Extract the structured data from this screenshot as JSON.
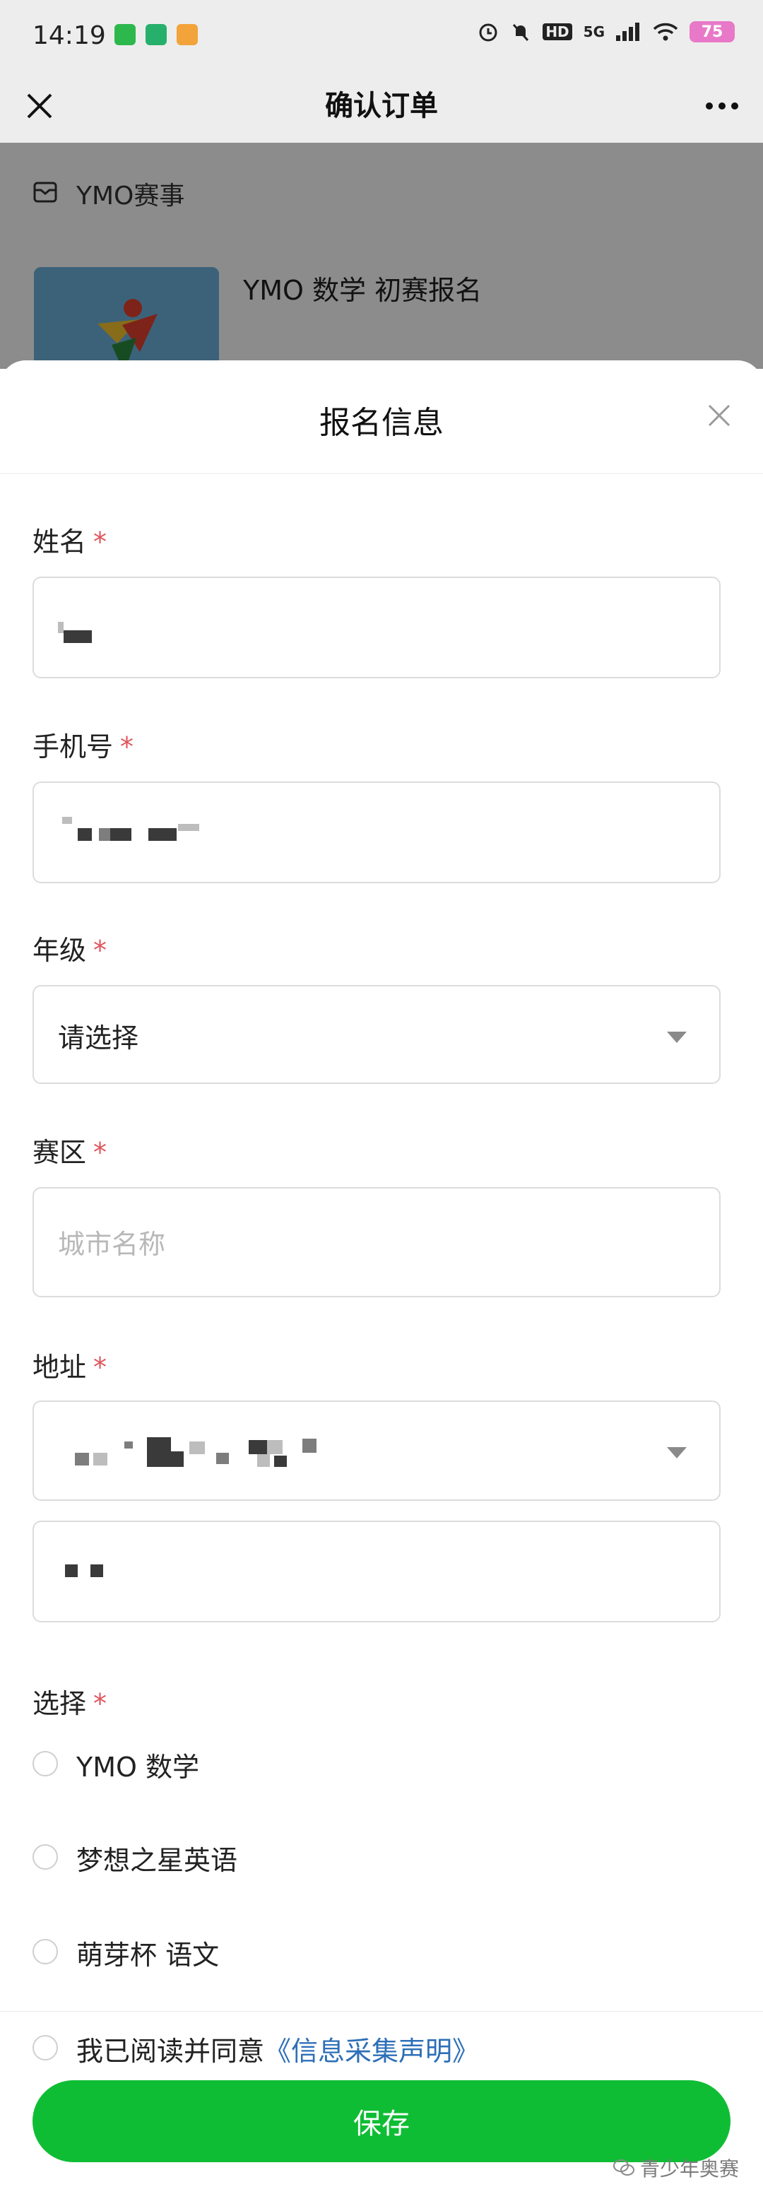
{
  "status_bar": {
    "time": "14:19",
    "network": "5G",
    "hd": "HD",
    "battery": "75"
  },
  "nav": {
    "title": "确认订单",
    "close_icon": "close-icon",
    "more_icon": "more-dots-icon"
  },
  "order": {
    "shop_name": "YMO赛事",
    "product_title": "YMO 数学 初赛报名"
  },
  "sheet": {
    "title": "报名信息",
    "required_mark": "*",
    "fields": {
      "name": {
        "label": "姓名"
      },
      "phone": {
        "label": "手机号"
      },
      "grade": {
        "label": "年级",
        "value": "请选择"
      },
      "region": {
        "label": "赛区",
        "placeholder": "城市名称"
      },
      "address": {
        "label": "地址"
      }
    },
    "choice": {
      "label": "选择",
      "options": [
        "YMO 数学",
        "梦想之星英语",
        "萌芽杯 语文"
      ]
    },
    "agree": {
      "text": "我已阅读并同意",
      "link": "《信息采集声明》"
    },
    "save_label": "保存"
  },
  "watermark": "青少年奥赛",
  "colors": {
    "primary": "#0fbd34",
    "link": "#2d6fb7",
    "required": "#e0545c"
  }
}
